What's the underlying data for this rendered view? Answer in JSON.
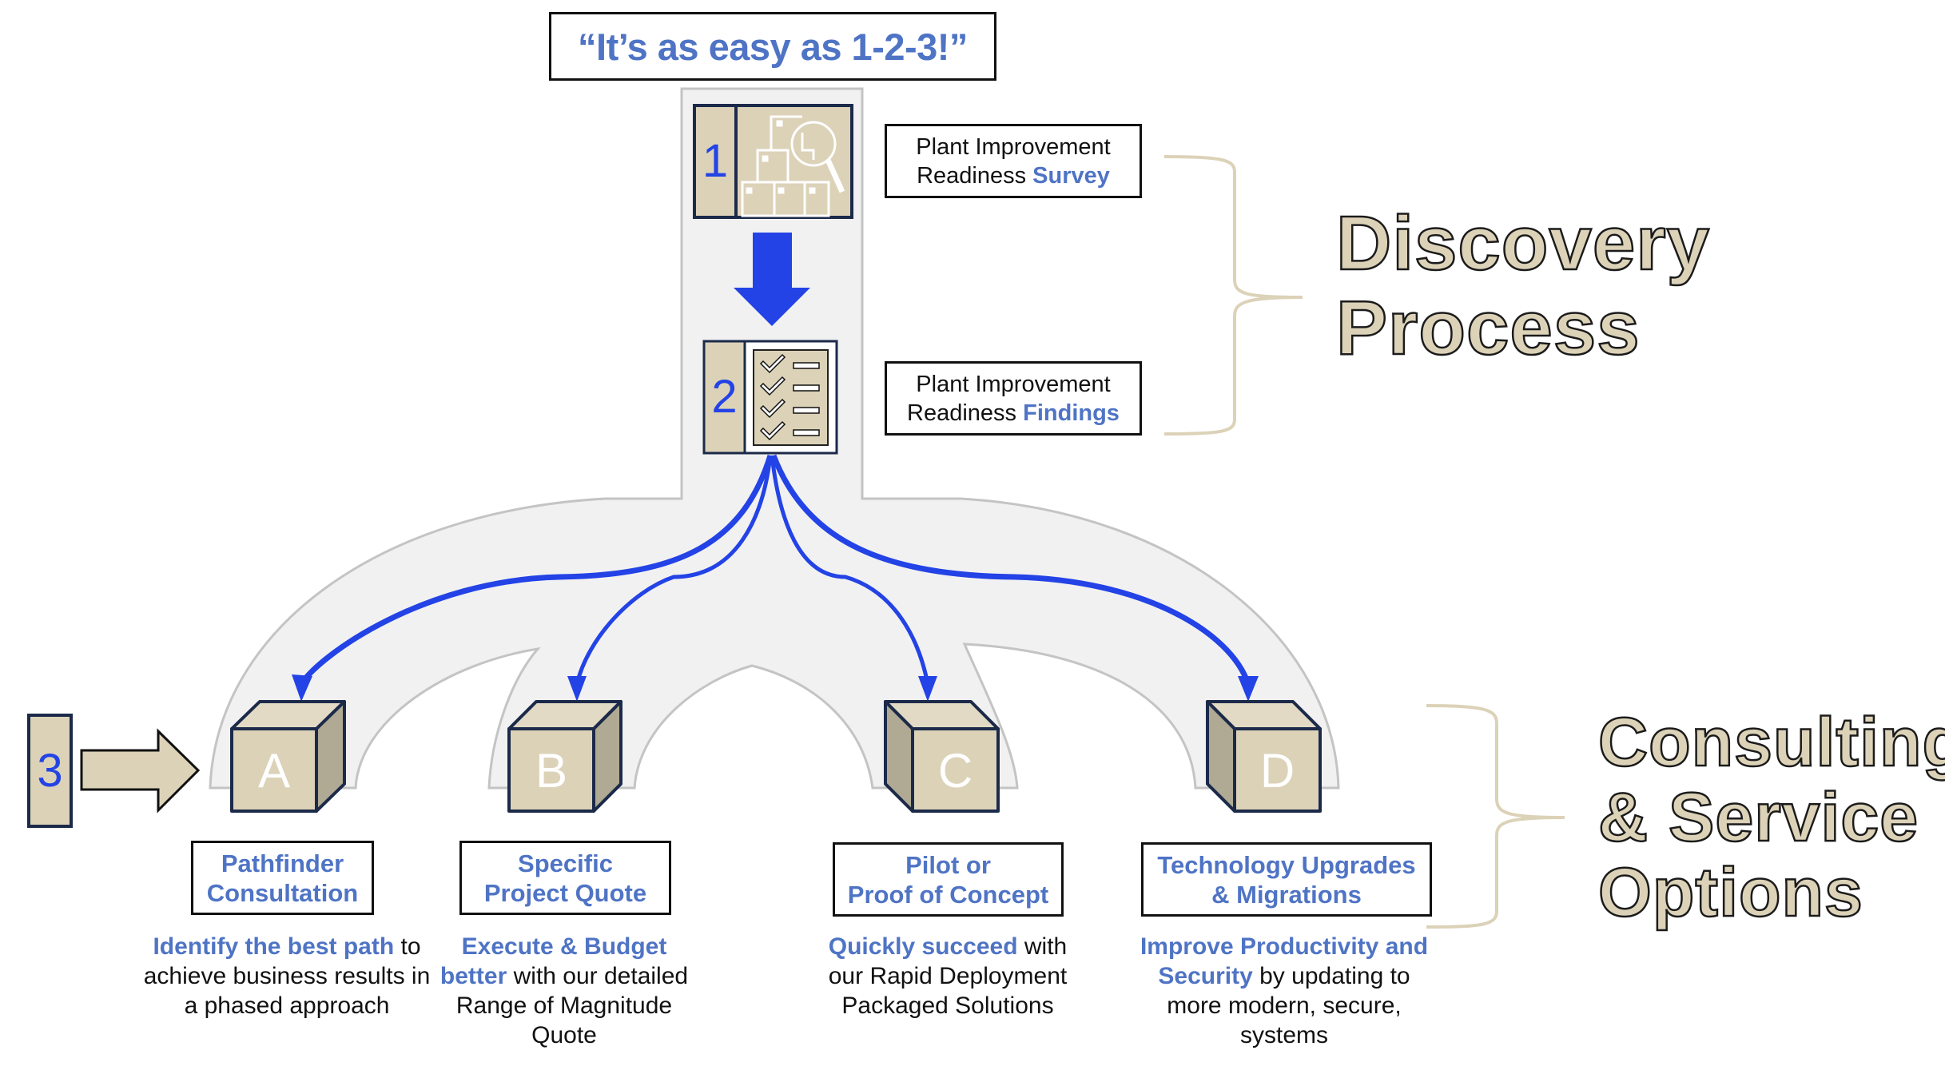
{
  "title": "“It’s as easy as 1-2-3!”",
  "steps": [
    {
      "number": "1",
      "icon": "boxes-magnifier-icon"
    },
    {
      "number": "2",
      "icon": "checklist-icon"
    },
    {
      "number": "3",
      "icon": "right-arrow-icon"
    }
  ],
  "discovery": {
    "survey": {
      "line1": "Plant Improvement",
      "line2_plain": "Readiness ",
      "line2_highlight": "Survey"
    },
    "findings": {
      "line1": "Plant Improvement",
      "line2_plain": "Readiness ",
      "line2_highlight": "Findings"
    },
    "heading_line1": "Discovery",
    "heading_line2": "Process"
  },
  "options_heading": {
    "line1": "Consulting",
    "line2": "& Service",
    "line3": "Options"
  },
  "options": [
    {
      "letter": "A",
      "label_line1": "Pathfinder",
      "label_line2": "Consultation",
      "desc_highlight": "Identify the best path",
      "desc_rest": "to achieve business results in a phased approach"
    },
    {
      "letter": "B",
      "label_line1": "Specific",
      "label_line2": "Project Quote",
      "desc_highlight": "Execute & Budget better",
      "desc_rest": "with our detailed Range of Magnitude Quote"
    },
    {
      "letter": "C",
      "label_line1": "Pilot or",
      "label_line2": "Proof of Concept",
      "desc_highlight": "Quickly succeed",
      "desc_rest": "with our Rapid Deployment Packaged Solutions"
    },
    {
      "letter": "D",
      "label_line1": "Technology Upgrades",
      "label_line2": "& Migrations",
      "desc_highlight": "Improve Productivity and Security",
      "desc_rest": "by updating to more modern, secure, systems"
    }
  ],
  "colors": {
    "accent_blue": "#2343e6",
    "text_blue": "#4f74c5",
    "tan": "#dcd2b8",
    "tan_dark": "#b0a993",
    "navy_outline": "#1c2a4a",
    "arch_fill": "#f1f1f1",
    "arch_stroke": "#c4c4c4",
    "brace": "#dcd2b8"
  }
}
